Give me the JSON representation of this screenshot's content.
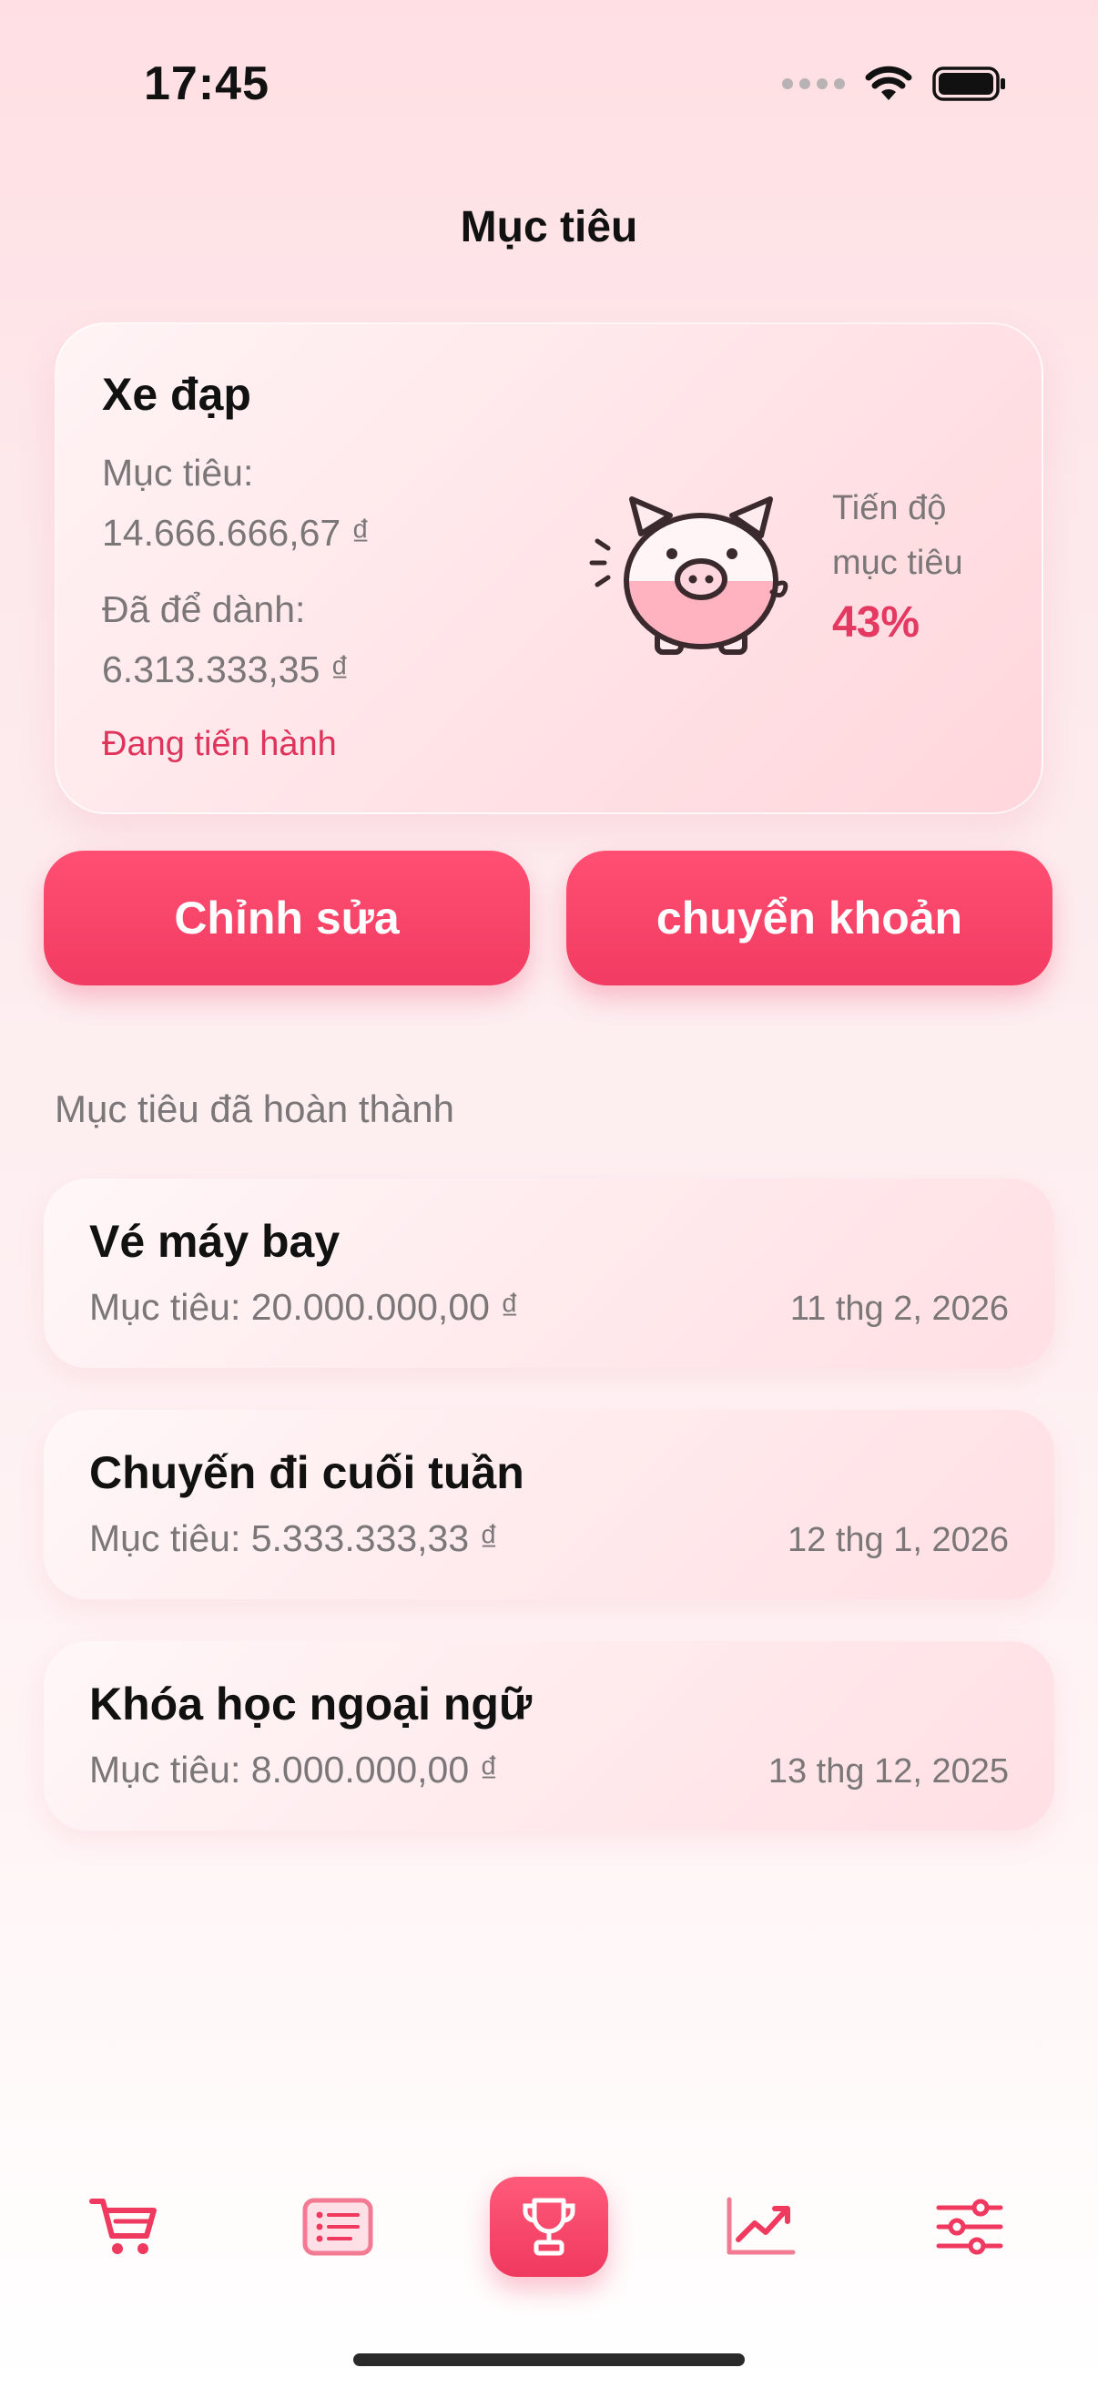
{
  "status_bar": {
    "time": "17:45"
  },
  "page_title": "Mục tiêu",
  "current_goal": {
    "name": "Xe đạp",
    "target_label": "Mục tiêu:",
    "target_amount": "14.666.666,67 ₫",
    "saved_label": "Đã để dành:",
    "saved_amount": "6.313.333,35 ₫",
    "status": "Đang tiến hành",
    "progress_label_line1": "Tiến độ",
    "progress_label_line2": "mục tiêu",
    "progress_value": "43%",
    "progress_fraction": 0.43
  },
  "actions": {
    "edit_label": "Chỉnh sửa",
    "transfer_label": "chuyển khoản"
  },
  "completed_section_title": "Mục tiêu đã hoàn thành",
  "completed_goals": [
    {
      "name": "Vé máy bay",
      "target": "Mục tiêu: 20.000.000,00 ₫",
      "date": "11 thg 2, 2026"
    },
    {
      "name": "Chuyến đi cuối tuần",
      "target": "Mục tiêu: 5.333.333,33 ₫",
      "date": "12 thg 1, 2026"
    },
    {
      "name": "Khóa học ngoại ngữ",
      "target": "Mục tiêu: 8.000.000,00 ₫",
      "date": "13 thg 12, 2025"
    }
  ],
  "tab_bar": {
    "tabs": [
      {
        "icon": "cart-icon",
        "active": false
      },
      {
        "icon": "list-icon",
        "active": false
      },
      {
        "icon": "trophy-icon",
        "active": true
      },
      {
        "icon": "chart-trend-icon",
        "active": false
      },
      {
        "icon": "sliders-icon",
        "active": false
      }
    ]
  },
  "colors": {
    "accent": "#f23b62",
    "accent_light": "#ff4f72",
    "status_text": "#e0335b",
    "muted_text": "#7b7779"
  }
}
